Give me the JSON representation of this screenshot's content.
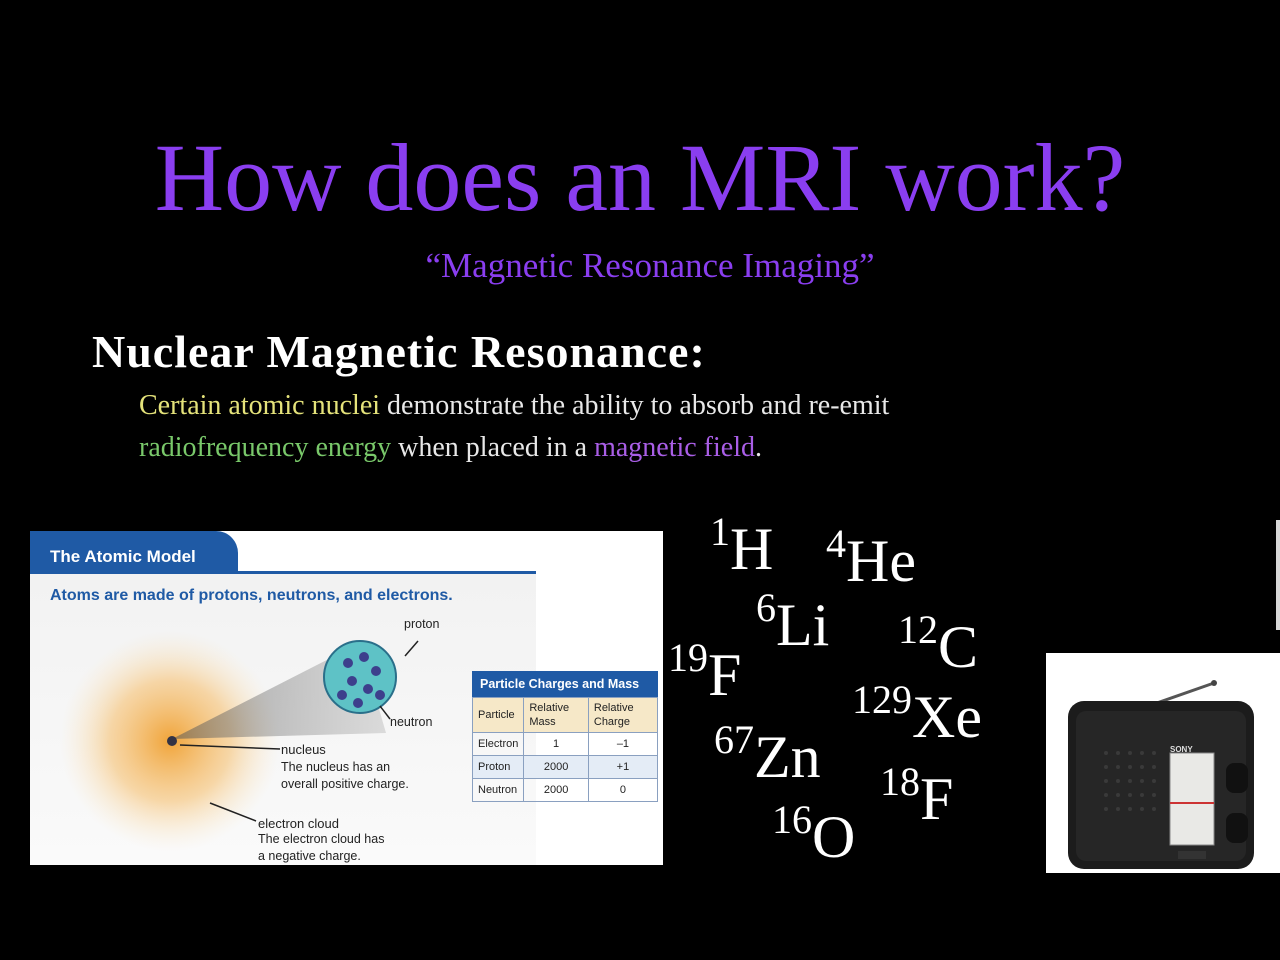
{
  "slide": {
    "title": "How does an MRI work?",
    "subtitle": "“Magnetic Resonance Imaging”",
    "heading": "Nuclear Magnetic Resonance:",
    "definition": {
      "part1": "Certain atomic nuclei",
      "part2": " demonstrate the ability to absorb and re-emit",
      "part3": "radiofrequency energy",
      "part4": " when placed in a ",
      "part5": "magnetic field",
      "part6": "."
    },
    "colors": {
      "title": "#8a3ef0",
      "highlight_nuclei": "#e4e27a",
      "highlight_rf": "#79c86a",
      "highlight_field": "#a95ee6"
    }
  },
  "atomic_model": {
    "tab": "The Atomic Model",
    "caption": "Atoms are made of protons, neutrons, and electrons.",
    "labels": {
      "proton": "proton",
      "neutron": "neutron",
      "nucleus": "nucleus",
      "nucleus_desc1": "The nucleus has an",
      "nucleus_desc2": "overall positive charge.",
      "electron_cloud": "electron cloud",
      "cloud_desc1": "The electron cloud has",
      "cloud_desc2": "a negative charge."
    },
    "table": {
      "title": "Particle Charges and Mass",
      "headers": [
        "Particle",
        "Relative Mass",
        "Relative Charge"
      ],
      "rows": [
        [
          "Electron",
          "1",
          "–1"
        ],
        [
          "Proton",
          "2000",
          "+1"
        ],
        [
          "Neutron",
          "2000",
          "0"
        ]
      ]
    }
  },
  "isotopes": [
    {
      "mass": "1",
      "symbol": "H"
    },
    {
      "mass": "4",
      "symbol": "He"
    },
    {
      "mass": "6",
      "symbol": "Li"
    },
    {
      "mass": "12",
      "symbol": "C"
    },
    {
      "mass": "19",
      "symbol": "F"
    },
    {
      "mass": "129",
      "symbol": "Xe"
    },
    {
      "mass": "67",
      "symbol": "Zn"
    },
    {
      "mass": "18",
      "symbol": "F"
    },
    {
      "mass": "16",
      "symbol": "O"
    }
  ],
  "radio": {
    "brand": "SONY"
  }
}
